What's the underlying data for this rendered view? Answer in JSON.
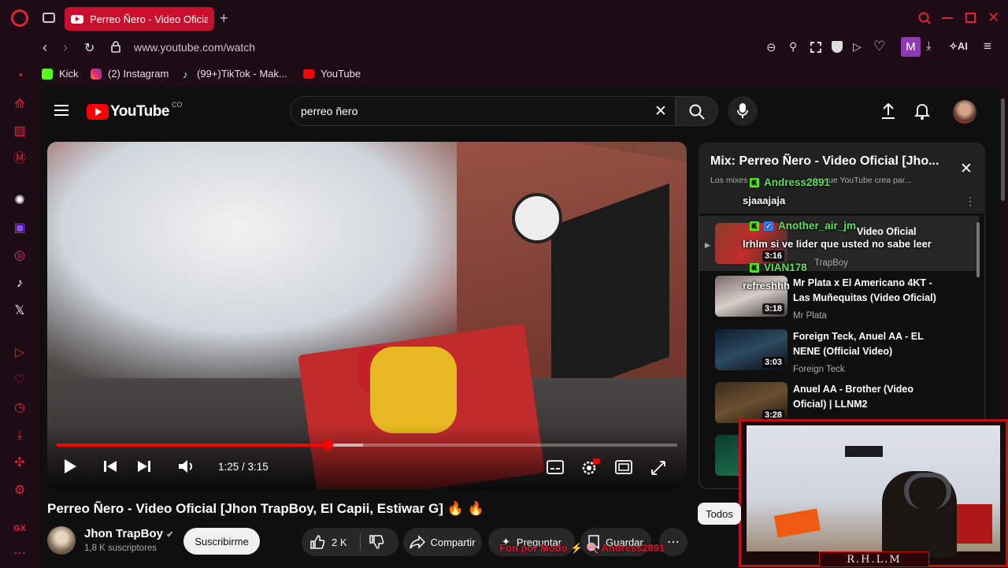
{
  "browser": {
    "tab_title": "Perreo Ñero - Video Oficial",
    "url": "www.youtube.com/watch",
    "ai_label": "AI",
    "profile_initial": "M",
    "bookmarks": [
      {
        "label": "Kick",
        "color": "#53fc18"
      },
      {
        "label": "(2) Instagram",
        "color": "#e1306c"
      },
      {
        "label": "(99+)TikTok - Mak...",
        "color": "#111111"
      },
      {
        "label": "YouTube",
        "color": "#ff0000"
      }
    ]
  },
  "youtube": {
    "logo_text": "YouTube",
    "logo_country": "CO",
    "search_value": "perreo ñero"
  },
  "player": {
    "time": "1:25 / 3:15",
    "progress": 0.436,
    "buffered": 0.494
  },
  "video": {
    "title": "Perreo Ñero - Video Oficial [Jhon TrapBoy, El Capii, Estiwar G] 🔥 🔥",
    "channel": "Jhon TrapBoy",
    "subscribers": "1,8 K suscriptores",
    "subscribe_label": "Suscribirme",
    "likes": "2 K",
    "share_label": "Compartir",
    "ask_label": "Preguntar",
    "save_label": "Guardar",
    "filter_all": "Todos"
  },
  "mix": {
    "title": "Mix: Perreo Ñero - Video Oficial [Jho...",
    "subtitle_start": "Los mixes",
    "subtitle_end": "ción que YouTube crea par...",
    "items": [
      {
        "title_end": "Video Oficial",
        "duration": "3:16",
        "channel": "TrapBoy"
      },
      {
        "title": "Mr Plata x El Americano 4KT - Las Muñequitas (Video Oficial)",
        "duration": "3:18",
        "channel": "Mr Plata"
      },
      {
        "title": "Foreign Teck, Anuel AA - EL NENE (Official Video)",
        "duration": "3:03",
        "channel": "Foreign Teck"
      },
      {
        "title": "Anuel AA - Brother (Video Oficial) | LLNM2",
        "duration": "3:28",
        "channel": ""
      }
    ]
  },
  "chat": [
    {
      "name": "Andress2891",
      "message": "sjaaajaja"
    },
    {
      "name": "Another_air_jm",
      "message": "lrhlm si ve lider que usted no sabe leer"
    },
    {
      "name": "VIAN178",
      "message": "refreshhh"
    }
  ],
  "stream": {
    "promo_text": "Fon por Modo ⚡ 🍭 Andress2891",
    "cam_label": "R.H.L.M"
  },
  "colors": {
    "accent": "#ff0000",
    "browser_red": "#e0243a",
    "kick_green": "#53fc18"
  }
}
